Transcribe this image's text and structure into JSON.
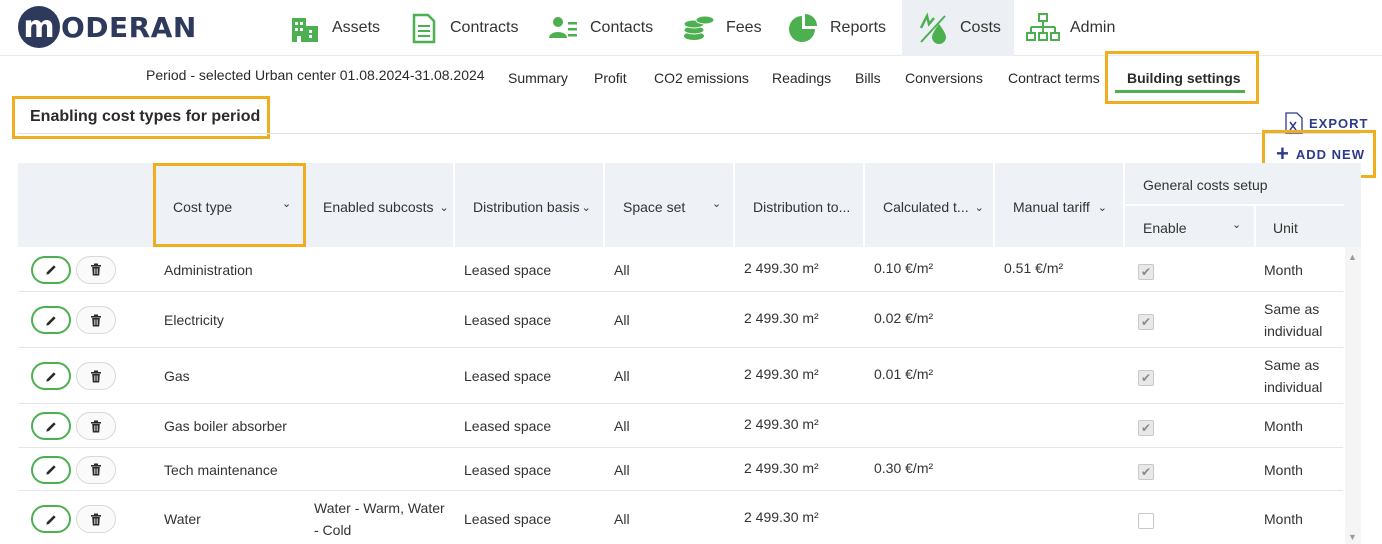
{
  "brand": {
    "logo_letter": "m",
    "logo_text": "ODERAN"
  },
  "nav": [
    {
      "label": "Assets",
      "icon": "building-icon"
    },
    {
      "label": "Contracts",
      "icon": "document-icon"
    },
    {
      "label": "Contacts",
      "icon": "contacts-icon"
    },
    {
      "label": "Fees",
      "icon": "coins-icon"
    },
    {
      "label": "Reports",
      "icon": "pie-chart-icon"
    },
    {
      "label": "Costs",
      "icon": "energy-costs-icon",
      "active": true
    },
    {
      "label": "Admin",
      "icon": "org-chart-icon"
    }
  ],
  "subnav": {
    "period": "Period - selected Urban center 01.08.2024-31.08.2024",
    "tabs": [
      "Summary",
      "Profit",
      "CO2 emissions",
      "Readings",
      "Bills",
      "Conversions",
      "Contract terms",
      "Building settings"
    ],
    "active_tab": "Building settings"
  },
  "section": {
    "title": "Enabling cost types for period"
  },
  "actions": {
    "export": "EXPORT",
    "add_new": "ADD NEW"
  },
  "table": {
    "headers": {
      "cost_type": "Cost type",
      "enabled_subcosts": "Enabled subcosts",
      "distribution_basis": "Distribution basis",
      "space_set": "Space set",
      "distribution_total": "Distribution to...",
      "calculated_tariff": "Calculated t...",
      "manual_tariff": "Manual tariff",
      "general_costs_setup": "General costs setup",
      "enable": "Enable",
      "unit": "Unit"
    },
    "rows": [
      {
        "cost_type": "Administration",
        "subcosts": "",
        "basis": "Leased space",
        "space_set": "All",
        "dist_total": "2 499.30 m²",
        "calc_tariff": "0.10 €/m²",
        "manual_tariff": "0.51 €/m²",
        "enabled": true,
        "unit": "Month"
      },
      {
        "cost_type": "Electricity",
        "subcosts": "",
        "basis": "Leased space",
        "space_set": "All",
        "dist_total": "2 499.30 m²",
        "calc_tariff": "0.02 €/m²",
        "manual_tariff": "",
        "enabled": true,
        "unit": "Same as individual"
      },
      {
        "cost_type": "Gas",
        "subcosts": "",
        "basis": "Leased space",
        "space_set": "All",
        "dist_total": "2 499.30 m²",
        "calc_tariff": "0.01 €/m²",
        "manual_tariff": "",
        "enabled": true,
        "unit": "Same as individual"
      },
      {
        "cost_type": "Gas boiler absorber",
        "subcosts": "",
        "basis": "Leased space",
        "space_set": "All",
        "dist_total": "2 499.30 m²",
        "calc_tariff": "",
        "manual_tariff": "",
        "enabled": true,
        "unit": "Month"
      },
      {
        "cost_type": "Tech maintenance",
        "subcosts": "",
        "basis": "Leased space",
        "space_set": "All",
        "dist_total": "2 499.30 m²",
        "calc_tariff": "0.30 €/m²",
        "manual_tariff": "",
        "enabled": true,
        "unit": "Month"
      },
      {
        "cost_type": "Water",
        "subcosts": "Water - Warm, Water - Cold",
        "basis": "Leased space",
        "space_set": "All",
        "dist_total": "2 499.30 m²",
        "calc_tariff": "",
        "manual_tariff": "",
        "enabled": false,
        "unit": "Month"
      }
    ]
  },
  "colors": {
    "accent_green": "#4caf50",
    "highlight": "#f0ad1f",
    "brand_navy": "#2e3a5c",
    "link_blue": "#2e3a8c"
  }
}
